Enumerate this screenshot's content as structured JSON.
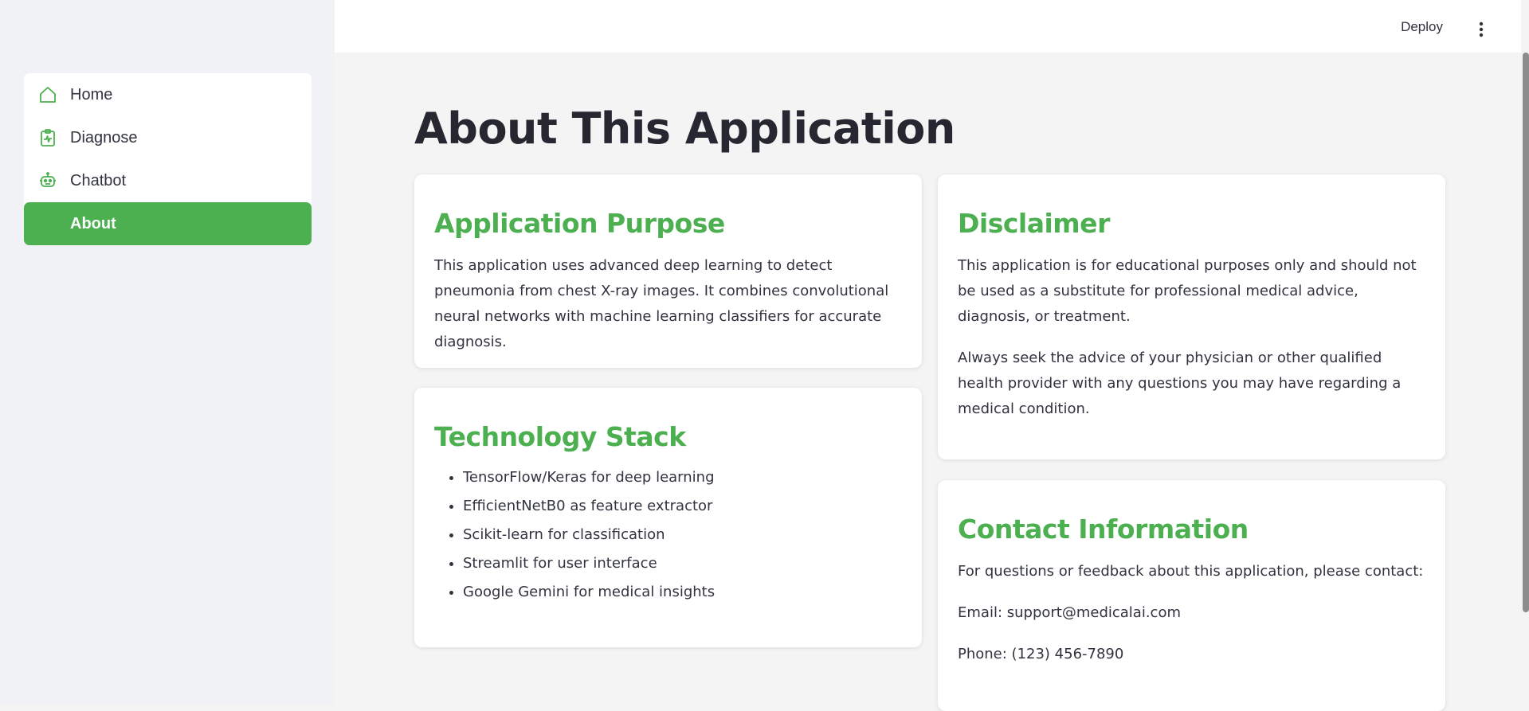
{
  "sidebar": {
    "items": [
      {
        "label": "Home",
        "icon": "home-icon",
        "active": false
      },
      {
        "label": "Diagnose",
        "icon": "clipboard-pulse-icon",
        "active": false
      },
      {
        "label": "Chatbot",
        "icon": "robot-icon",
        "active": false
      },
      {
        "label": "About",
        "icon": "info-icon",
        "active": true
      }
    ]
  },
  "header": {
    "deploy_label": "Deploy",
    "menu_icon": "more-vertical-icon"
  },
  "main": {
    "title": "About This Application",
    "purpose": {
      "title": "Application Purpose",
      "text": "This application uses advanced deep learning to detect pneumonia from chest X-ray images. It combines convolutional neural networks with machine learning classifiers for accurate diagnosis."
    },
    "technology": {
      "title": "Technology Stack",
      "items": [
        "TensorFlow/Keras for deep learning",
        "EfficientNetB0 as feature extractor",
        "Scikit-learn for classification",
        "Streamlit for user interface",
        "Google Gemini for medical insights"
      ]
    },
    "disclaimer": {
      "title": "Disclaimer",
      "paragraphs": [
        "This application is for educational purposes only and should not be used as a substitute for professional medical advice, diagnosis, or treatment.",
        "Always seek the advice of your physician or other qualified health provider with any questions you may have regarding a medical condition."
      ]
    },
    "contact": {
      "title": "Contact Information",
      "intro": "For questions or feedback about this application, please contact:",
      "email": "Email: support@medicalai.com",
      "phone": "Phone: (123) 456-7890"
    }
  },
  "colors": {
    "accent": "#4caf50",
    "text": "#31333f",
    "title": "#262730",
    "background": "#f4f4f4",
    "sidebar_bg": "#f0f2f6"
  }
}
